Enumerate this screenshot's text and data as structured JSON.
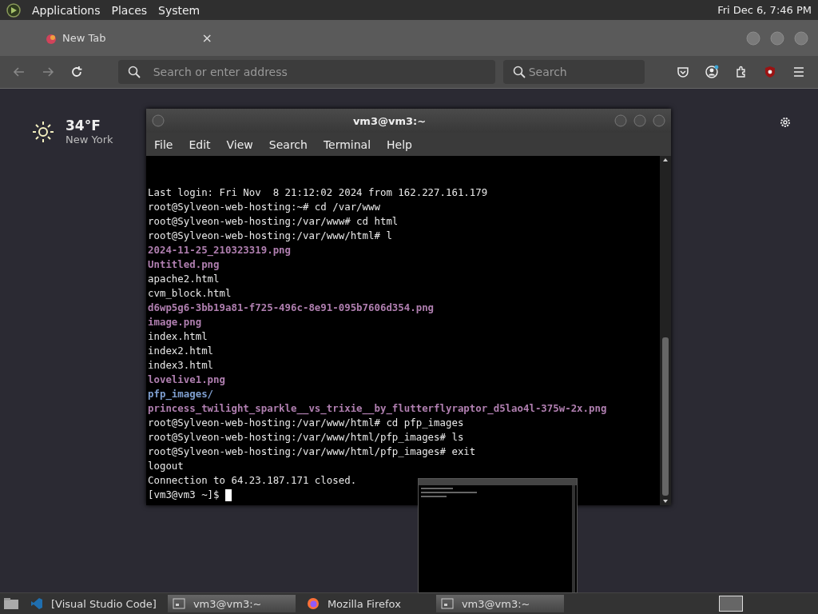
{
  "top_panel": {
    "menus": [
      "Applications",
      "Places",
      "System"
    ],
    "clock": "Fri Dec 6, 7:46 PM"
  },
  "browser": {
    "tab": {
      "title": "New Tab",
      "close": "×"
    },
    "address": {
      "placeholder": "Search or enter address"
    },
    "search": {
      "placeholder": "Search"
    }
  },
  "weather": {
    "temperature": "34°F",
    "city": "New York"
  },
  "terminal": {
    "title": "vm3@vm3:~",
    "menu": [
      "File",
      "Edit",
      "View",
      "Search",
      "Terminal",
      "Help"
    ],
    "lines": [
      {
        "text": "Last login: Fri Nov  8 21:12:02 2024 from 162.227.161.179",
        "kind": "plain"
      },
      {
        "text": "root@Sylveon-web-hosting:~# cd /var/www",
        "kind": "plain"
      },
      {
        "text": "root@Sylveon-web-hosting:/var/www# cd html",
        "kind": "plain"
      },
      {
        "text": "root@Sylveon-web-hosting:/var/www/html# l",
        "kind": "plain"
      },
      {
        "text": "2024-11-25_210323319.png"
      },
      {
        "text": "Untitled.png"
      },
      {
        "text": "apache2.html",
        "kind": "plain"
      },
      {
        "text": "cvm_block.html",
        "kind": "plain"
      },
      {
        "text": "d6wp5g6-3bb19a81-f725-496c-8e91-095b7606d354.png"
      },
      {
        "text": "image.png"
      },
      {
        "text": "index.html",
        "kind": "plain"
      },
      {
        "text": "index2.html",
        "kind": "plain"
      },
      {
        "text": "index3.html",
        "kind": "plain"
      },
      {
        "text": "lovelive1.png"
      },
      {
        "text": "pfp_images/",
        "kind": "directory"
      },
      {
        "text": "princess_twilight_sparkle__vs_trixie__by_flutterflyraptor_d5lao4l-375w-2x.png"
      },
      {
        "text": "root@Sylveon-web-hosting:/var/www/html# cd pfp_images",
        "kind": "plain"
      },
      {
        "text": "root@Sylveon-web-hosting:/var/www/html/pfp_images# ls",
        "kind": "plain"
      },
      {
        "text": "root@Sylveon-web-hosting:/var/www/html/pfp_images# exit",
        "kind": "plain"
      },
      {
        "text": "logout",
        "kind": "plain"
      },
      {
        "text": "Connection to 64.23.187.171 closed.",
        "kind": "plain"
      },
      {
        "text": "[vm3@vm3 ~]$ ",
        "kind": "prompt"
      }
    ]
  },
  "taskbar": {
    "items": [
      {
        "label": "[Visual Studio Code]",
        "kind": "code",
        "selected": false
      },
      {
        "label": "vm3@vm3:~",
        "kind": "terminal",
        "selected": true
      },
      {
        "label": "Mozilla Firefox",
        "kind": "browser",
        "selected": false
      },
      {
        "label": "vm3@vm3:~",
        "kind": "terminal",
        "selected": true
      }
    ]
  }
}
